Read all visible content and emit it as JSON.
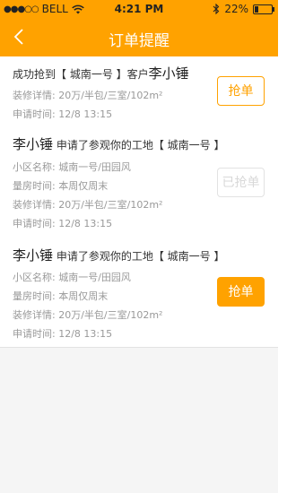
{
  "status_bar": {
    "signal_dots": "●●●○○",
    "carrier": "BELL",
    "wifi_icon": "wifi-icon",
    "time": "4:21 PM",
    "bluetooth_icon": "bluetooth-icon",
    "battery_percent": "22%",
    "battery_level": 0.22
  },
  "nav": {
    "back_icon": "chevron-left-icon",
    "title": "订单提醒"
  },
  "colors": {
    "accent": "#ffa200",
    "text_dark": "#333333",
    "text_gray": "#999999",
    "background": "#f5f5f5"
  },
  "notifications": [
    {
      "headline_prefix": "成功抢到【 城南一号 】客户",
      "customer_name": "李小锤",
      "details": [
        {
          "label": "装修详情:",
          "value": "20万/半包/三室/102m²"
        },
        {
          "label": "申请时间:",
          "value": "12/8  13:15"
        }
      ],
      "button_label": "抢单",
      "button_state": "outline"
    },
    {
      "customer_name": "李小锤",
      "headline_suffix": "申请了参观你的工地【 城南一号 】",
      "details": [
        {
          "label": "小区名称:",
          "value": "城南一号/田园风"
        },
        {
          "label": "量房时间:",
          "value": "本周仅周末"
        },
        {
          "label": "装修详情:",
          "value": "20万/半包/三室/102m²"
        },
        {
          "label": "申请时间:",
          "value": "12/8  13:15"
        }
      ],
      "button_label": "已抢单",
      "button_state": "disabled"
    },
    {
      "customer_name": "李小锤",
      "headline_suffix": "申请了参观你的工地【 城南一号 】",
      "details": [
        {
          "label": "小区名称:",
          "value": "城南一号/田园风"
        },
        {
          "label": "量房时间:",
          "value": "本周仅周末"
        },
        {
          "label": "装修详情:",
          "value": "20万/半包/三室/102m²"
        },
        {
          "label": "申请时间:",
          "value": "12/8  13:15"
        }
      ],
      "button_label": "抢单",
      "button_state": "filled"
    }
  ]
}
